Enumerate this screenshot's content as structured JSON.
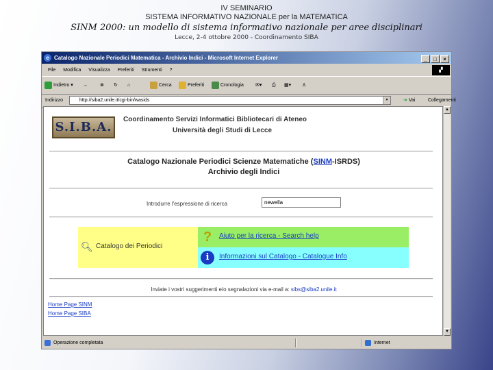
{
  "slide": {
    "line1": "IV SEMINARIO",
    "line2": "SISTEMA INFORMATIVO NAZIONALE per la MATEMATICA",
    "line3": "SINM 2000: un modello di sistema informativo nazionale per aree disciplinari",
    "line4": "Lecce, 2-4 ottobre 2000 - Coordinamento SIBA"
  },
  "browser": {
    "title": "Catalogo Nazionale Periodici Matematica - Archivio Indici - Microsoft Internet Explorer",
    "window_buttons": [
      "_",
      "□",
      "×"
    ],
    "menu": [
      "File",
      "Modifica",
      "Visualizza",
      "Preferiti",
      "Strumenti",
      "?"
    ],
    "toolbar": {
      "back": "Indietro",
      "forward": "→",
      "stop": "⊗",
      "refresh": "↻",
      "home": "⌂",
      "search": "Cerca",
      "favorites": "Preferiti",
      "history": "Cronologia"
    },
    "address": {
      "label": "Indirizzo",
      "url": "http://siba2.unile.it/cgi-bin/wasids",
      "go": "Vai",
      "links": "Collegamenti"
    },
    "status": {
      "text": "Operazione completata",
      "zone": "Internet"
    },
    "accent": "#0a246a"
  },
  "page": {
    "logo_text": "S.I.B.A.",
    "coord": "Coordinamento Servizi Informatici Bibliotecari di Ateneo",
    "univ": "Università degli Studi di Lecce",
    "title_pre": "Catalogo Nazionale Periodici Scienze Matematiche (",
    "title_link": "SINM",
    "title_post": "-ISRDS)",
    "subtitle": "Archivio degli Indici",
    "search_label": "Introdurre l'espressione di ricerca",
    "search_value": "newella",
    "yellow_text": "Catalogo dei Periodici",
    "help_link": "Aiuto per la ricerca - Search help",
    "info_link": "Informazioni sul Catalogo - Catalogue Info",
    "footer_pre": "Inviate i vostri suggerimenti e/o segnalazioni via e-mail a: ",
    "footer_email": "sibs@siba2.unile.it",
    "home_links": [
      "Home Page SINM",
      "Home Page SIBA"
    ]
  }
}
